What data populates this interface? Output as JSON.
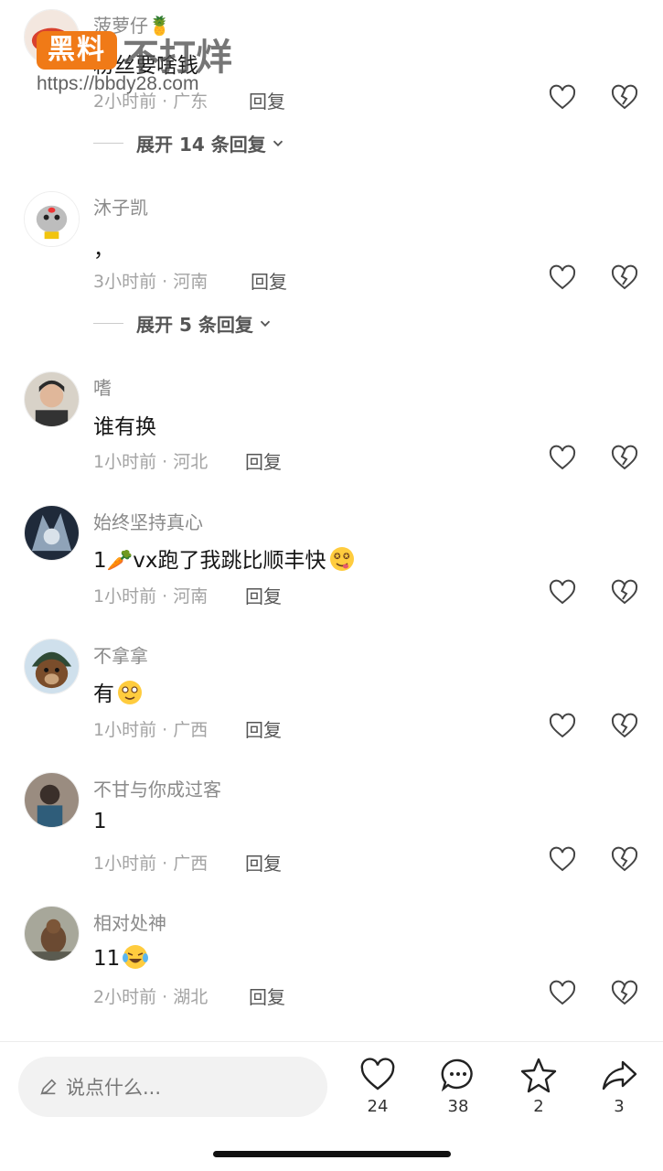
{
  "watermark": {
    "badge": "黑料",
    "text": "不打烊",
    "url": "https://bbdy28.com"
  },
  "reply_label": "回复",
  "comments": [
    {
      "user": "菠萝仔🍍",
      "content": "粉丝要啥钱",
      "time": "2小时前 · 广东",
      "expand": "展开 14 条回复",
      "avatar_icon": "red-fish-avatar"
    },
    {
      "user": "沐子凯",
      "content": "，",
      "time": "3小时前 · 河南",
      "expand": "展开 5 条回复",
      "avatar_icon": "cartoon-cat-avatar"
    },
    {
      "user": "嗜",
      "content": "谁有换",
      "time": "1小时前 · 河北",
      "avatar_icon": "man-portrait-avatar"
    },
    {
      "user": "始终坚持真心",
      "content": "1🥕vx跑了我跳比顺丰快",
      "time": "1小时前 · 河南",
      "avatar_icon": "anime-character-avatar",
      "emoji": "dizzy-tongue-emoji"
    },
    {
      "user": "不拿拿",
      "content": "有",
      "time": "1小时前 · 广西",
      "avatar_icon": "bear-helmet-avatar",
      "emoji": "smile-emoji"
    },
    {
      "user": "不甘与你成过客",
      "content": "1",
      "time": "1小时前 · 广西",
      "avatar_icon": "person-photo-avatar"
    },
    {
      "user": "相对处神",
      "content": "11",
      "time": "2小时前 · 湖北",
      "avatar_icon": "monkey-photo-avatar",
      "emoji": "laugh-cry-emoji"
    }
  ],
  "bottom_bar": {
    "input_placeholder": "说点什么...",
    "likes": "24",
    "comments": "38",
    "favorites": "2",
    "shares": "3"
  }
}
